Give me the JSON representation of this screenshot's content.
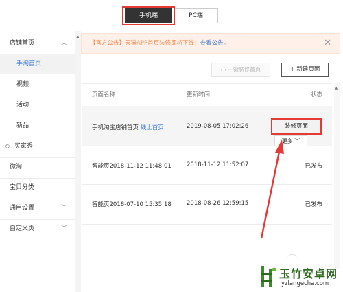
{
  "top_switch": {
    "mobile_label": "手机端",
    "pc_label": "PC端"
  },
  "sidebar": {
    "items": [
      {
        "label": "店铺首页",
        "chevron": "︿"
      },
      {
        "label": "手淘首页"
      },
      {
        "label": "视频"
      },
      {
        "label": "活动"
      },
      {
        "label": "新品"
      },
      {
        "label": "买家秀"
      },
      {
        "label": "微淘"
      },
      {
        "label": "宝贝分类"
      },
      {
        "label": "通用设置",
        "chevron": "﹀"
      },
      {
        "label": "自定义页",
        "chevron": "﹀"
      }
    ]
  },
  "notice": {
    "text": "【官方公告】天猫APP首页装修即将下线！",
    "link": "查看公告",
    "suffix": "。",
    "close": "✕"
  },
  "toolbar": {
    "one_click_label": "一键装修首页",
    "new_page_label": "+ 新建页面"
  },
  "table": {
    "headers": {
      "name": "页面名称",
      "time": "更新时间",
      "status": "状态"
    },
    "rows": [
      {
        "name": "手机淘宝店铺首页",
        "tag": "线上首页",
        "time": "2019-08-05 17:02:26",
        "action": "装修页面",
        "more": "更多 ﹀"
      },
      {
        "name": "智能页2018-11-12 11:48:01",
        "time": "2018-11-12 11:52:07",
        "status": "已发布"
      },
      {
        "name": "智能页2018-07-10 15:35:18",
        "time": "2018-08-26 12:59:15",
        "status": "已发布"
      }
    ]
  },
  "watermark": {
    "title": "玉竹安卓网",
    "url": "yzlangecha.com"
  },
  "colors": {
    "accent": "#3d7ad6",
    "annotation_red": "#e53935",
    "notice_text": "#f08a4b"
  }
}
